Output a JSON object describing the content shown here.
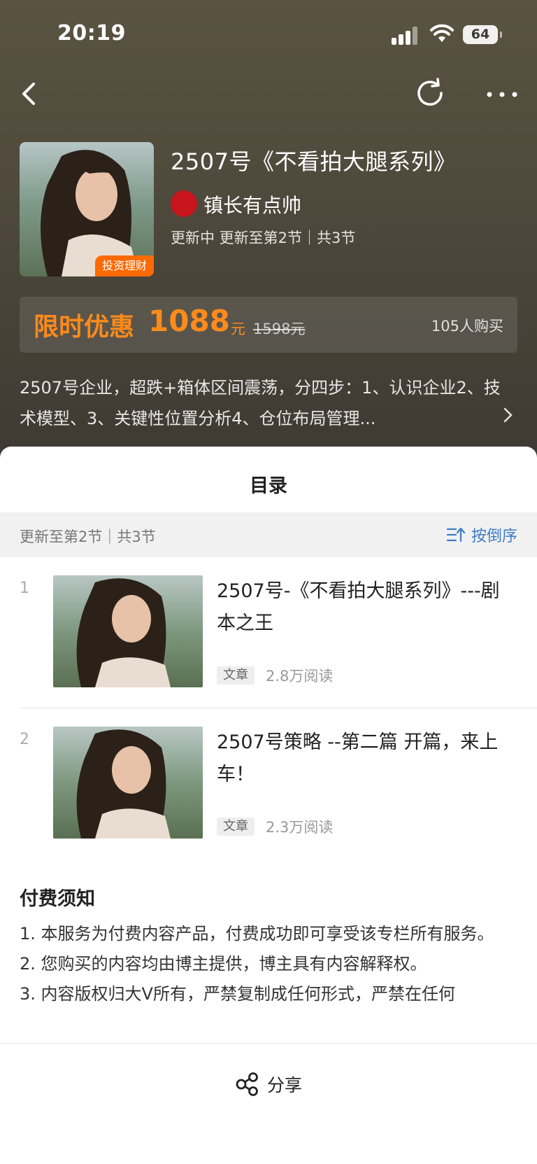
{
  "status_bar": {
    "time": "20:19",
    "battery": "64"
  },
  "header": {
    "title": "2507号《不看拍大腿系列》",
    "author": "镇长有点帅",
    "update_info": "更新中 更新至第2节｜共3节",
    "cover_tag": "投资理财"
  },
  "price": {
    "promo_label": "限时优惠",
    "promo_price": "1088",
    "promo_unit": "元",
    "original_price": "1598元",
    "buyers": "105人购买"
  },
  "description": "2507号企业，超跌+箱体区间震荡，分四步：1、认识企业2、技术模型、3、关键性位置分析4、仓位布局管理...",
  "toc": {
    "title": "目录",
    "count": "更新至第2节｜共3节",
    "sort_label": "按倒序"
  },
  "chapters": [
    {
      "index": "1",
      "title": "2507号-《不看拍大腿系列》---剧本之王",
      "tag": "文章",
      "reads": "2.8万阅读"
    },
    {
      "index": "2",
      "title": "2507号策略 --第二篇 开篇，来上车！",
      "tag": "文章",
      "reads": "2.3万阅读"
    }
  ],
  "notice": {
    "title": "付费须知",
    "items": [
      "1. 本服务为付费内容产品，付费成功即可享受该专栏所有服务。",
      "2. 您购买的内容均由博主提供，博主具有内容解释权。",
      "3. 内容版权归大V所有，严禁复制成任何形式，严禁在任何"
    ]
  },
  "share": {
    "label": "分享"
  },
  "colors": {
    "accent_orange": "#ff8a1c",
    "link_blue": "#3e7cc6",
    "tag_orange": "#ff6a00"
  },
  "icons": [
    "back-icon",
    "refresh-icon",
    "more-icon",
    "chevron-right-icon",
    "sort-icon",
    "share-icon",
    "wifi-icon",
    "signal-icon"
  ]
}
